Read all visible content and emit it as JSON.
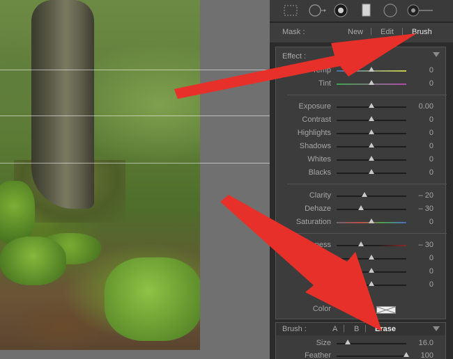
{
  "toolbar": {
    "tools": [
      "marquee-icon",
      "spot-removal-icon",
      "red-eye-icon",
      "graduated-filter-icon",
      "radial-filter-icon",
      "adjustment-brush-icon"
    ]
  },
  "mask": {
    "label": "Mask :",
    "options": [
      "New",
      "Edit",
      "Brush"
    ],
    "active": "Brush"
  },
  "effect": {
    "label": "Effect :",
    "groups": [
      [
        {
          "label": "Temp",
          "value": "0",
          "level": 0.5,
          "tint": "temp"
        },
        {
          "label": "Tint",
          "value": "0",
          "level": 0.5,
          "tint": "tint"
        }
      ],
      [
        {
          "label": "Exposure",
          "value": "0.00",
          "level": 0.5
        },
        {
          "label": "Contrast",
          "value": "0",
          "level": 0.5
        },
        {
          "label": "Highlights",
          "value": "0",
          "level": 0.5
        },
        {
          "label": "Shadows",
          "value": "0",
          "level": 0.5
        },
        {
          "label": "Whites",
          "value": "0",
          "level": 0.5
        },
        {
          "label": "Blacks",
          "value": "0",
          "level": 0.5
        }
      ],
      [
        {
          "label": "Clarity",
          "value": "– 20",
          "level": 0.4
        },
        {
          "label": "Dehaze",
          "value": "– 30",
          "level": 0.35
        },
        {
          "label": "Saturation",
          "value": "0",
          "level": 0.5,
          "tint": "sat"
        }
      ],
      [
        {
          "label": "Sharpness",
          "value": "– 30",
          "level": 0.35,
          "tint": "sharp"
        },
        {
          "label": "Noise",
          "value": "0",
          "level": 0.5
        },
        {
          "label": "",
          "value": "0",
          "level": 0.5
        },
        {
          "label": "",
          "value": "0",
          "level": 0.5
        }
      ]
    ],
    "color_label": "Color"
  },
  "brush": {
    "label": "Brush :",
    "options": [
      "A",
      "B",
      "Erase"
    ],
    "active": "Erase",
    "size_label": "Size",
    "size_value": "16.0",
    "size_level": 0.16,
    "feather_label": "Feather",
    "feather_value": "100",
    "feather_level": 1.0
  },
  "colors": {
    "panel": "#2b2b2b",
    "arrow": "#e8302a",
    "active_text": "#e8e8e8"
  }
}
